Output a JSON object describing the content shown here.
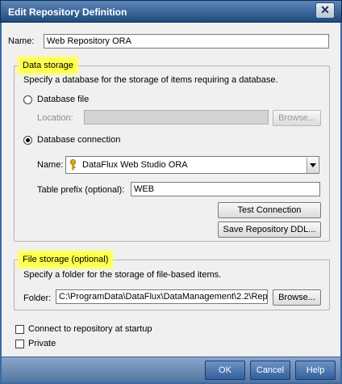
{
  "window": {
    "title": "Edit Repository Definition"
  },
  "name_field": {
    "label": "Name:",
    "value": "Web Repository ORA"
  },
  "data_storage": {
    "legend": "Data storage",
    "description": "Specify a database for the storage of items requiring a database.",
    "database_file": {
      "label": "Database file",
      "checked": false,
      "location_label": "Location:",
      "location_value": "",
      "browse_label": "Browse..."
    },
    "database_connection": {
      "label": "Database connection",
      "checked": true,
      "name_label": "Name:",
      "name_value": "DataFlux Web Studio ORA",
      "prefix_label": "Table prefix (optional):",
      "prefix_value": "WEB",
      "test_label": "Test Connection",
      "save_ddl_label": "Save Repository DDL..."
    }
  },
  "file_storage": {
    "legend": "File storage (optional)",
    "description": "Specify a folder for the storage of file-based items.",
    "folder_label": "Folder:",
    "folder_value": "C:\\ProgramData\\DataFlux\\DataManagement\\2.2\\Rep",
    "browse_label": "Browse..."
  },
  "options": {
    "connect_startup": {
      "label": "Connect to repository at startup",
      "checked": false
    },
    "private": {
      "label": "Private",
      "checked": false
    }
  },
  "footer": {
    "ok_label": "OK",
    "cancel_label": "Cancel",
    "help_label": "Help"
  }
}
